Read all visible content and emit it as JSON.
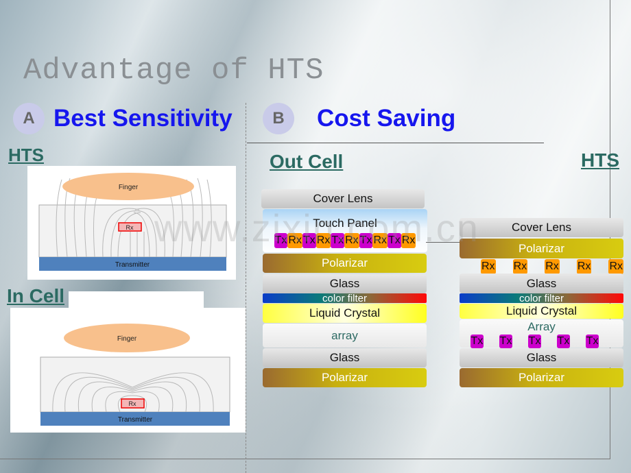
{
  "title": "Advantage of HTS",
  "section_a": {
    "badge": "A",
    "heading": "Best Sensitivity"
  },
  "section_b": {
    "badge": "B",
    "heading": "Cost Saving"
  },
  "left": {
    "hts_label": "HTS",
    "incell_label": "In Cell",
    "diagram": {
      "finger": "Finger",
      "rx": "Rx",
      "transmitter": "Transmitter"
    }
  },
  "right": {
    "outcell_label": "Out Cell",
    "hts_label": "HTS",
    "outcell_stack": {
      "cover": "Cover Lens",
      "touch_panel": "Touch Panel",
      "chips": [
        "Tx",
        "Rx",
        "Tx",
        "Rx",
        "Tx",
        "Rx",
        "Tx",
        "Rx",
        "Tx",
        "Rx"
      ],
      "polarizar_top": "Polarizar",
      "glass_top": "Glass",
      "color_filter": "color filter",
      "liquid_crystal": "Liquid Crystal",
      "array": "array",
      "glass_bottom": "Glass",
      "polarizar_bottom": "Polarizar"
    },
    "hts_stack": {
      "cover": "Cover Lens",
      "polarizar_top": "Polarizar",
      "rx_chips": [
        "Rx",
        "Rx",
        "Rx",
        "Rx",
        "Rx"
      ],
      "glass_top": "Glass",
      "color_filter": "color filter",
      "liquid_crystal": "Liquid Crystal",
      "array": "Array",
      "tx_chips": [
        "Tx",
        "Tx",
        "Tx",
        "Tx",
        "Tx"
      ],
      "glass_bottom": "Glass",
      "polarizar_bottom": "Polarizar"
    }
  },
  "watermark": "www.zixin.com.cn",
  "colors": {
    "heading": "#1616ee",
    "sublabel": "#2b6a62",
    "tx": "#cc00cc",
    "rx": "#ff9900",
    "finger": "#f8c08c",
    "transmitter": "#4f81bd"
  }
}
